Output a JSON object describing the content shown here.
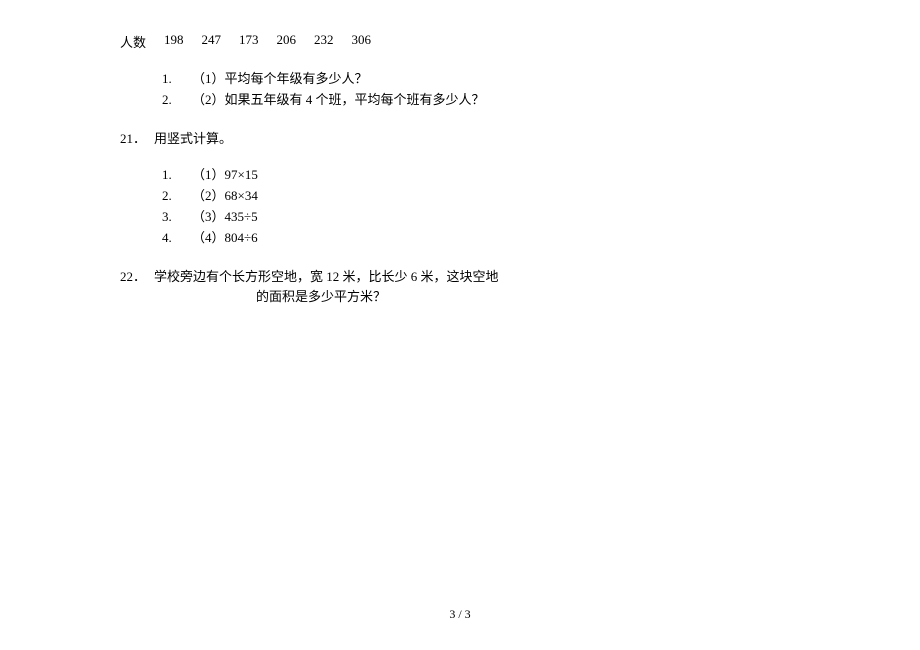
{
  "table": {
    "label": "人数",
    "values": [
      "198",
      "247",
      "173",
      "206",
      "232",
      "306"
    ]
  },
  "q20": {
    "subs": [
      {
        "num": "1.",
        "text": "（1）平均每个年级有多少人？"
      },
      {
        "num": "2.",
        "text": "（2）如果五年级有 4 个班，平均每个班有多少人？"
      }
    ]
  },
  "q21": {
    "num": "21．",
    "title": "用竖式计算。",
    "subs": [
      {
        "num": "1.",
        "text": "（1）97×15"
      },
      {
        "num": "2.",
        "text": "（2）68×34"
      },
      {
        "num": "3.",
        "text": "（3）435÷5"
      },
      {
        "num": "4.",
        "text": "（4）804÷6"
      }
    ]
  },
  "q22": {
    "num": "22．",
    "line1": "学校旁边有个长方形空地，宽 12 米，比长少 6 米，这块空地",
    "line2": "的面积是多少平方米？"
  },
  "footer": "3  /  3"
}
